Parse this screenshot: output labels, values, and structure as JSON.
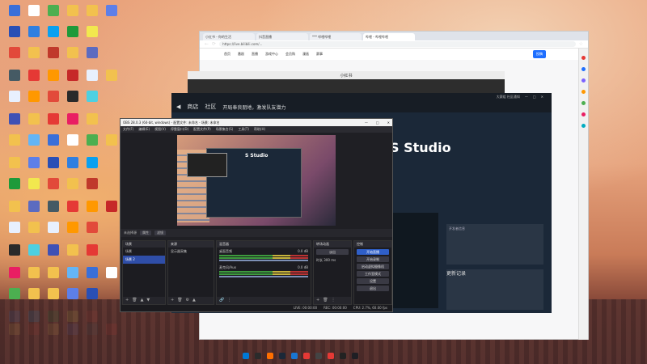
{
  "desktop": {
    "icon_colors": [
      "#3a6fd8",
      "#ffffff",
      "#4caf50",
      "#f2c14e",
      "#f2c14e",
      "#5d7fe8",
      "#2a4fb5",
      "#2f7fe0",
      "#0aa0f0",
      "#1d9a3a",
      "#f2e84e",
      "#e24a3a",
      "#f2c14e",
      "#c0392b",
      "#f2c14e",
      "#5c6bc0",
      "#455a64",
      "#e53935",
      "#ff9800",
      "#c62828",
      "#e8f0fe",
      "#f2c14e",
      "#e8f0fe",
      "#ff9800",
      "#e24a3a",
      "#2a2a2a",
      "#4dd0e1",
      "#3f51b5",
      "#f2c14e",
      "#e53935",
      "#e91e63",
      "#f2c14e",
      "#f2c14e",
      "#64b5f6"
    ],
    "taskbar_colors": [
      "#0078d4",
      "#2b2b2b",
      "#ff6f00",
      "#1b2838",
      "#1976d2",
      "#e53935",
      "#444",
      "#e53935",
      "#222",
      "#1f1f24"
    ]
  },
  "browser": {
    "tabs": [
      "小红书 - 你的生活",
      "抖音直播",
      "*** 哔哩哔哩",
      "哔哩 - 哔哩哔哩"
    ],
    "url": "https://live.bilibili.com/...",
    "nav_items": [
      "首页",
      "番剧",
      "直播",
      "游戏中心",
      "会员购",
      "漫画",
      "赛事"
    ],
    "upload_label": "投稿",
    "side_colors": [
      "#e53935",
      "#1e6fff",
      "#7b61ff",
      "#ff9800",
      "#4caf50",
      "#e91e63",
      "#00acc1"
    ]
  },
  "behind_window": {
    "title": "小红书"
  },
  "steam": {
    "menu": [
      "商店",
      "社区"
    ],
    "notice": "开局奉良朋地，激发队友潜力",
    "top_info": "大赛组 社区通知",
    "banner_title": "S Studio",
    "panel1_title": "开发者信息",
    "panel2_title": "更新记录"
  },
  "obs": {
    "title": "OBS 28.0.3 (64-bit, windows) - 配置文件: 未命名 - 场景: 未命名",
    "menus": [
      "文件(F)",
      "编辑(E)",
      "视图(V)",
      "停靠窗口(D)",
      "配置文件(P)",
      "场景集合(S)",
      "工具(T)",
      "帮助(H)"
    ],
    "scene_label": "未选择源",
    "props_label": "属性",
    "filters_label": "滤镜",
    "docks": {
      "scenes": {
        "title": "场景",
        "items": [
          "场景",
          "场景 2"
        ],
        "selected": 1
      },
      "sources": {
        "title": "来源",
        "items": [
          "显示器采集"
        ]
      },
      "mixer": {
        "title": "混音器",
        "rows": [
          {
            "name": "桌面音频",
            "db": "0.0 dB"
          },
          {
            "name": "麦克风/Aux",
            "db": "0.0 dB"
          }
        ]
      },
      "transitions": {
        "title": "转场动画",
        "type": "淡出",
        "duration_label": "时长",
        "duration": "300 ms"
      },
      "controls": {
        "title": "控制",
        "buttons": [
          "开始直播",
          "开始录制",
          "启动虚拟摄像机",
          "工作室模式",
          "设置",
          "退出"
        ]
      }
    },
    "status": {
      "live": "LIVE: 00:00:00",
      "rec": "REC: 00:00:00",
      "cpu": "CPU: 2.7%, 60.00 fps"
    }
  }
}
